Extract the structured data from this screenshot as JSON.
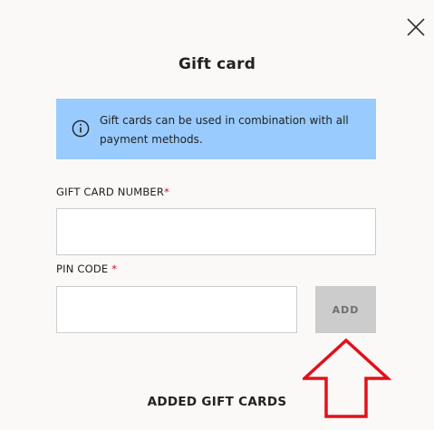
{
  "modal": {
    "title": "Gift card",
    "info_text": "Gift cards can be used in combination with all payment methods.",
    "info_icon": "info-circle-icon",
    "close_icon": "close-icon"
  },
  "form": {
    "gift_card_number": {
      "label": "GIFT CARD NUMBER",
      "required_marker": "*",
      "value": "",
      "placeholder": ""
    },
    "pin_code": {
      "label": "PIN CODE ",
      "required_marker": "*",
      "value": "",
      "placeholder": ""
    },
    "add_button_label": "ADD"
  },
  "added_section": {
    "title": "ADDED GIFT CARDS"
  },
  "annotation": {
    "icon": "up-arrow-outline-icon",
    "color": "#e3101a"
  },
  "colors": {
    "background": "#faf9f8",
    "info_bg": "#99cbfe",
    "button_disabled_bg": "#cccccc",
    "required": "#c8102e"
  }
}
